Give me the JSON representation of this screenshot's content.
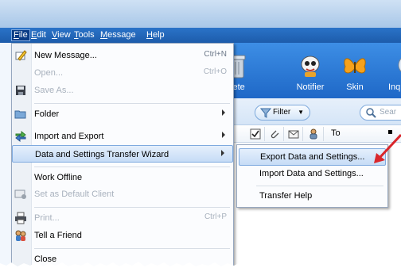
{
  "menubar": {
    "items": [
      {
        "label": "File",
        "accel": "F",
        "rest": "ile"
      },
      {
        "label": "Edit",
        "accel": "E",
        "rest": "dit"
      },
      {
        "label": "View",
        "accel": "V",
        "rest": "iew"
      },
      {
        "label": "Tools",
        "accel": "T",
        "rest": "ools"
      },
      {
        "label": "Message",
        "accel": "M",
        "rest": "essage"
      },
      {
        "label": "Help",
        "accel": "H",
        "rest": "elp"
      }
    ]
  },
  "toolbar": {
    "delete_label": "Delete",
    "notifier_label": "Notifier",
    "skin_label": "Skin",
    "inq_label": "Inq"
  },
  "filter_bar": {
    "filter_label": "Filter",
    "search_placeholder": "Sear"
  },
  "column_header": {
    "to_label": "To"
  },
  "file_menu": {
    "items": [
      {
        "label": "New Message...",
        "shortcut": "Ctrl+N",
        "icon": "new-message-icon",
        "disabled": false
      },
      {
        "label": "Open...",
        "shortcut": "Ctrl+O",
        "icon": "",
        "disabled": true
      },
      {
        "label": "Save As...",
        "shortcut": "",
        "icon": "save-icon",
        "disabled": true
      },
      {
        "label": "Folder",
        "shortcut": "",
        "icon": "folder-icon",
        "disabled": false,
        "submenu": true
      },
      {
        "label": "Import and Export",
        "shortcut": "",
        "icon": "import-export-icon",
        "disabled": false,
        "submenu": true
      },
      {
        "label": "Data and Settings Transfer Wizard",
        "shortcut": "",
        "icon": "",
        "disabled": false,
        "submenu": true,
        "highlighted": true
      },
      {
        "label": "Work Offline",
        "shortcut": "",
        "icon": "",
        "disabled": false
      },
      {
        "label": "Set as Default Client",
        "shortcut": "",
        "icon": "default-client-icon",
        "disabled": true
      },
      {
        "label": "Print...",
        "shortcut": "Ctrl+P",
        "icon": "print-icon",
        "disabled": true
      },
      {
        "label": "Tell a Friend",
        "shortcut": "",
        "icon": "tell-friend-icon",
        "disabled": false
      },
      {
        "label": "Close",
        "shortcut": "",
        "icon": "",
        "disabled": false
      }
    ]
  },
  "submenu": {
    "items": [
      {
        "label": "Export Data and Settings...",
        "highlighted": true
      },
      {
        "label": "Import Data and Settings...",
        "highlighted": false
      },
      {
        "label": "Transfer Help",
        "highlighted": false
      }
    ]
  },
  "colors": {
    "menubar": "#1d5cab",
    "highlight": "#c6dcf6",
    "annotation_arrow": "#d9262b"
  }
}
